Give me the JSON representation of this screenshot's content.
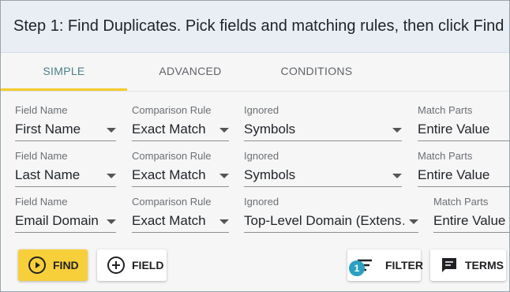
{
  "header": {
    "title": "Step 1: Find Duplicates. Pick fields and matching rules, then click Find"
  },
  "tabs": [
    {
      "label": "SIMPLE",
      "active": true
    },
    {
      "label": "ADVANCED",
      "active": false
    },
    {
      "label": "CONDITIONS",
      "active": false
    }
  ],
  "rows": [
    {
      "field_name": {
        "label": "Field Name",
        "value": "First Name"
      },
      "comparison_rule": {
        "label": "Comparison Rule",
        "value": "Exact Match"
      },
      "ignored": {
        "label": "Ignored",
        "value": "Symbols"
      },
      "match_parts": {
        "label": "Match Parts",
        "value": "Entire Value"
      }
    },
    {
      "field_name": {
        "label": "Field Name",
        "value": "Last Name"
      },
      "comparison_rule": {
        "label": "Comparison Rule",
        "value": "Exact Match"
      },
      "ignored": {
        "label": "Ignored",
        "value": "Symbols"
      },
      "match_parts": {
        "label": "Match Parts",
        "value": "Entire Value"
      }
    },
    {
      "field_name": {
        "label": "Field Name",
        "value": "Email Domain"
      },
      "comparison_rule": {
        "label": "Comparison Rule",
        "value": "Exact Match"
      },
      "ignored": {
        "label": "Ignored",
        "value": "Top-Level Domain (Extens…"
      },
      "match_parts": {
        "label": "Match Parts",
        "value": "Entire Value"
      }
    }
  ],
  "buttons": {
    "find": "FIND",
    "field": "FIELD",
    "filter": "FILTER",
    "filter_badge": "1",
    "terms": "TERMS"
  },
  "colors": {
    "accent_yellow": "#f7cf3a",
    "tab_active_text": "#4a7f87",
    "badge": "#2aa1c0",
    "header_bg": "#e9eef4"
  }
}
